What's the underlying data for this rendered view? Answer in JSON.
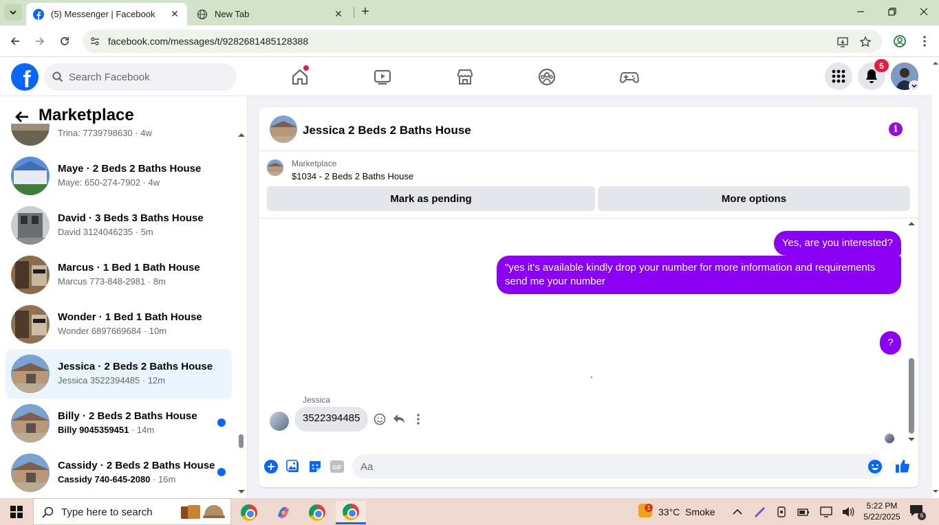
{
  "browser": {
    "tabs": [
      {
        "title": "(5) Messenger | Facebook",
        "active": true
      },
      {
        "title": "New Tab",
        "active": false
      }
    ],
    "url": "facebook.com/messages/t/9282681485128388"
  },
  "fb_header": {
    "logo": "f",
    "search_placeholder": "Search Facebook",
    "notification_count": "5",
    "nav_icons": [
      "home-icon",
      "video-icon",
      "marketplace-icon",
      "groups-icon",
      "gaming-icon"
    ]
  },
  "marketplace": {
    "title": "Marketplace",
    "conversations": [
      {
        "name": "",
        "sub": "Trina: 7739798630 · 4w",
        "unread": false,
        "selected": false
      },
      {
        "name": "Maye · 2 Beds 2 Baths House",
        "sub": "Maye: 650-274-7902 · 4w",
        "unread": false,
        "selected": false
      },
      {
        "name": "David · 3 Beds 3 Baths House",
        "sub": "David 3124046235 · 5m",
        "unread": false,
        "selected": false
      },
      {
        "name": "Marcus · 1 Bed 1 Bath House",
        "sub": "Marcus 773-848-2981 · 8m",
        "unread": false,
        "selected": false
      },
      {
        "name": "Wonder · 1 Bed 1 Bath House",
        "sub": "Wonder 6897669684 · 10m",
        "unread": false,
        "selected": false
      },
      {
        "name": "Jessica · 2 Beds 2 Baths House",
        "sub": "Jessica 3522394485 · 12m",
        "unread": false,
        "selected": true
      },
      {
        "name": "Billy · 2 Beds 2 Baths House",
        "sub": "Billy 9045359451",
        "time": " · 14m",
        "unread": true,
        "selected": false
      },
      {
        "name": "Cassidy · 2 Beds 2 Baths House",
        "sub": "Cassidy 740-645-2080",
        "time": " · 16m",
        "unread": true,
        "selected": false
      }
    ]
  },
  "chat": {
    "title": "Jessica 2 Beds 2 Baths House",
    "listing_category": "Marketplace",
    "listing_price": "$1034 - 2 Beds 2 Baths House",
    "mark_pending_label": "Mark as pending",
    "more_options_label": "More options",
    "messages_out": [
      "Yes, are you interested?",
      "\"yes it's available kindly drop your number for more information and requirements send me your number",
      "?"
    ],
    "sender_name": "Jessica",
    "message_in": "3522394485",
    "composer_placeholder": "Aa"
  },
  "taskbar": {
    "search_placeholder": "Type here to search",
    "weather_badge": "1",
    "temperature": "33°C",
    "weather": "Smoke",
    "time": "5:22 PM",
    "date": "5/22/2025",
    "notification_count": "6"
  },
  "colors": {
    "fb_blue": "#0866ff",
    "messenger_purple": "#8a00f5",
    "selected_bg": "#ebf5ff",
    "browser_tabbar": "#d3e3c9"
  }
}
